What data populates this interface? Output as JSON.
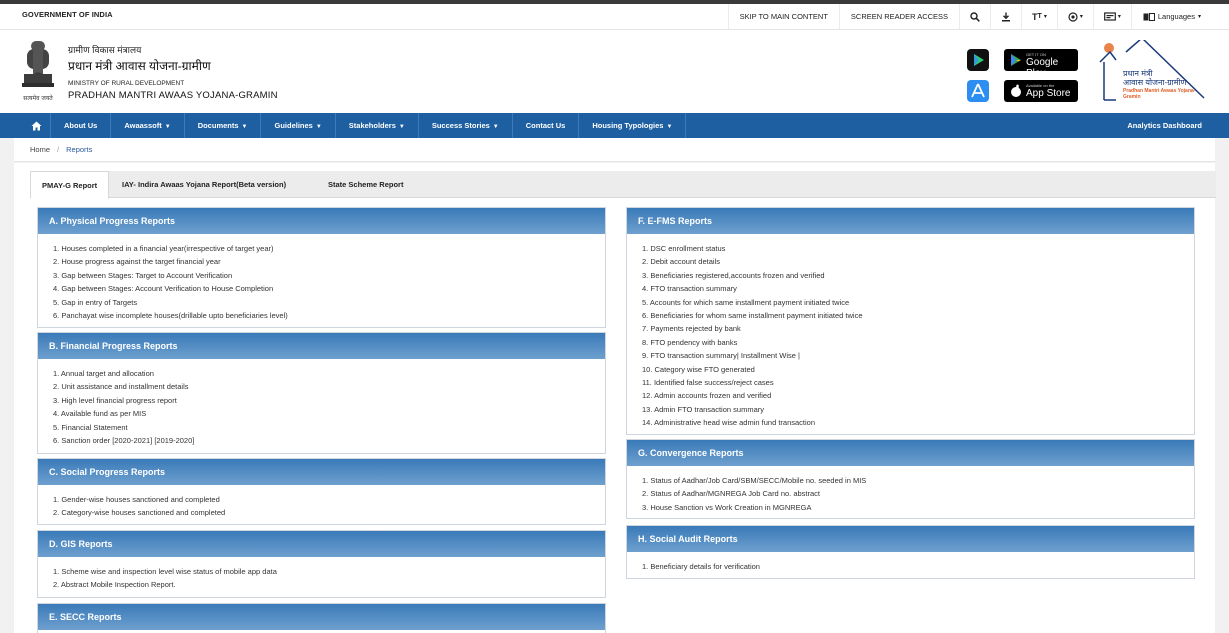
{
  "gov_bar": {
    "label": "GOVERNMENT OF INDIA",
    "skip_link": "SKIP TO MAIN CONTENT",
    "screen_reader": "SCREEN READER ACCESS",
    "text_size": "T",
    "languages": "Languages"
  },
  "header": {
    "emblem_caption": "सत्यमेव जयते",
    "ministry_hi": "ग्रामीण विकास मंत्रालय",
    "scheme_hi": "प्रधान मंत्री आवास योजना-ग्रामीण",
    "ministry_en": "MINISTRY OF RURAL DEVELOPMENT",
    "scheme_en": "PRADHAN MANTRI AWAAS YOJANA-GRAMIN",
    "google_play_small": "GET IT ON",
    "google_play": "Google Play",
    "app_store_small": "Available on the",
    "app_store": "App Store",
    "logo_line1": "प्रधान मंत्री",
    "logo_line2": "आवास योजना-ग्रामीण",
    "logo_line3": "Pradhan Mantri Awaas Yojana-Gramin"
  },
  "nav": {
    "items": [
      {
        "label": "About Us",
        "caret": false
      },
      {
        "label": "Awaassoft",
        "caret": true
      },
      {
        "label": "Documents",
        "caret": true
      },
      {
        "label": "Guidelines",
        "caret": true
      },
      {
        "label": "Stakeholders",
        "caret": true
      },
      {
        "label": "Success Stories",
        "caret": true
      },
      {
        "label": "Contact Us",
        "caret": false
      },
      {
        "label": "Housing Typologies",
        "caret": true
      }
    ],
    "right": "Analytics Dashboard"
  },
  "breadcrumb": {
    "home": "Home",
    "current": "Reports"
  },
  "tabs": [
    "PMAY-G Report",
    "IAY- Indira Awaas Yojana Report(Beta version)",
    "State Scheme Report"
  ],
  "panels": {
    "a": {
      "title": "A. Physical Progress Reports",
      "items": [
        "1. Houses completed in a financial year(irrespective of target year)",
        "2. House progress against the target financial year",
        "3. Gap between Stages: Target to Account Verification",
        "4. Gap between Stages: Account Verification to House Completion",
        "5. Gap in entry of Targets",
        "6. Panchayat wise incomplete houses(drillable upto beneficiaries level)"
      ]
    },
    "b": {
      "title": "B. Financial Progress Reports",
      "items": [
        "1. Annual target and allocation",
        "2. Unit assistance and installment details",
        "3. High level financial progress report",
        "4. Available fund as per MIS",
        "5. Financial Statement",
        "6. Sanction order [2020-2021] [2019-2020]"
      ]
    },
    "c": {
      "title": "C. Social Progress Reports",
      "items": [
        "1. Gender-wise houses sanctioned and completed",
        "2. Category-wise houses sanctioned and completed"
      ]
    },
    "d": {
      "title": "D. GIS Reports",
      "items": [
        "1. Scheme wise and inspection level wise status of mobile app data",
        "2. Abstract Mobile Inspection Report."
      ]
    },
    "e": {
      "title": "E. SECC Reports",
      "items": []
    },
    "f": {
      "title": "F. E-FMS Reports",
      "items": [
        "1. DSC enrollment status",
        "2. Debit account details",
        "3. Beneficiaries registered,accounts frozen and verified",
        "4. FTO transaction summary",
        "5. Accounts for which same installment payment initiated twice",
        "6. Beneficiaries for whom same installment payment initiated twice",
        "7. Payments rejected by bank",
        "8. FTO pendency with banks",
        "9. FTO transaction summary| Installment Wise |",
        "10. Category wise FTO generated",
        "11. Identified false success/reject cases",
        "12. Admin accounts frozen and verified",
        "13. Admin FTO transaction summary",
        "14. Administrative head wise admin fund transaction"
      ]
    },
    "g": {
      "title": "G. Convergence Reports",
      "items": [
        "1. Status of Aadhar/Job Card/SBM/SECC/Mobile no. seeded in MIS",
        "2. Status of Aadhar/MGNREGA Job Card no. abstract",
        "3. House Sanction vs Work Creation in MGNREGA"
      ]
    },
    "h": {
      "title": "H. Social Audit Reports",
      "items": [
        "1. Beneficiary details for verification"
      ]
    }
  }
}
